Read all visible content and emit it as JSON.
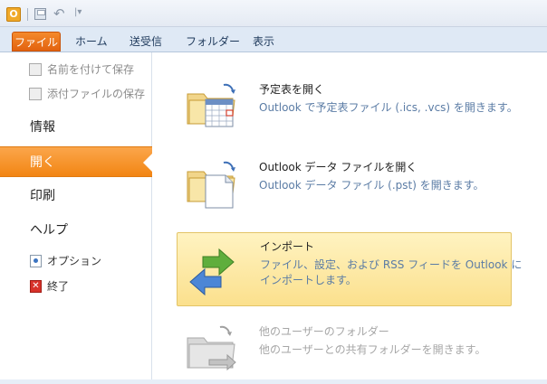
{
  "quick_access": {
    "app_letter": "O"
  },
  "ribbon": {
    "tabs": [
      "ファイル",
      "ホーム",
      "送受信",
      "フォルダー",
      "表示"
    ]
  },
  "sidebar": {
    "save_as": "名前を付けて保存",
    "save_attachments": "添付ファイルの保存",
    "info": "情報",
    "open": "開く",
    "print": "印刷",
    "help": "ヘルプ",
    "options": "オプション",
    "exit": "終了"
  },
  "main": {
    "actions": [
      {
        "title": "予定表を開く",
        "desc": "Outlook で予定表ファイル (.ics, .vcs) を開きます。"
      },
      {
        "title": "Outlook データ ファイルを開く",
        "desc": "Outlook データ ファイル (.pst) を開きます。"
      },
      {
        "title": "インポート",
        "desc": "ファイル、設定、および RSS フィードを Outlook にインポートします。"
      },
      {
        "title": "他のユーザーのフォルダー",
        "desc": "他のユーザーとの共有フォルダーを開きます。"
      }
    ]
  },
  "colors": {
    "file_tab": "#e2620f",
    "nav_active": "#f28513",
    "selected_action": "#fbe08d",
    "desc_text": "#5b7ca5"
  }
}
